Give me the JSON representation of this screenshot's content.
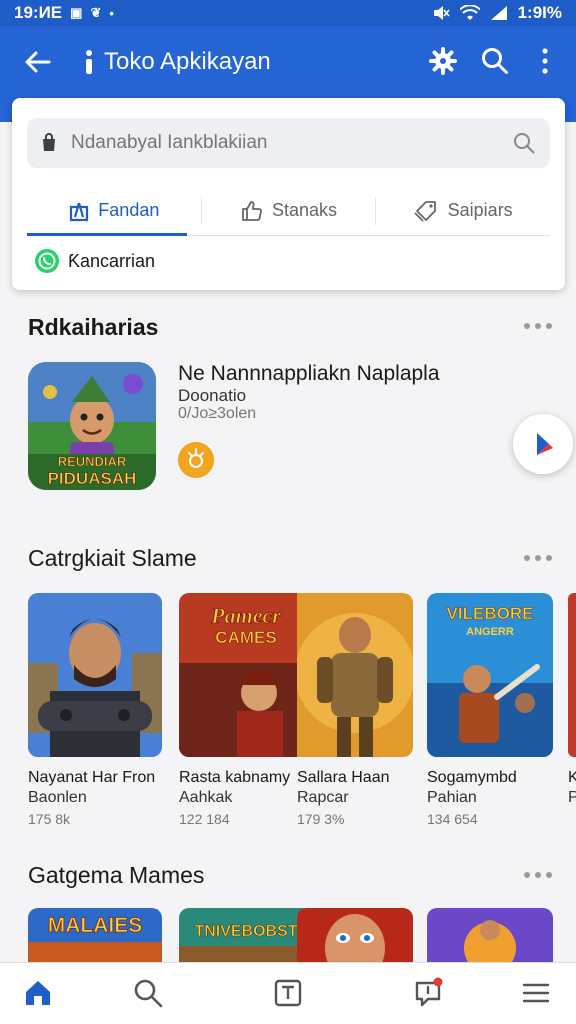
{
  "status_bar": {
    "time": "19:ИE",
    "right_text": "1:9I%"
  },
  "app_bar": {
    "title": "Toko Apkikayan"
  },
  "search": {
    "placeholder": "Ndanabyal Iankblakiian"
  },
  "tabs": [
    {
      "label": "Fandan",
      "active": true,
      "icon": "bag-icon"
    },
    {
      "label": "Stanaks",
      "active": false,
      "icon": "thumbs-up-icon"
    },
    {
      "label": "Saipiars",
      "active": false,
      "icon": "tag-icon"
    }
  ],
  "chip": {
    "label": "Ƙancarrian",
    "icon": "whatsapp-icon"
  },
  "section_1": {
    "title": "Rdkaiharias",
    "featured": {
      "title": "Ne Nannnappliakn Naplapla",
      "subtitle": "Doonatio",
      "meta": "0/Jo≥3olen",
      "art_text_top": "REUNDIAR",
      "art_text_bottom": "PIDUASAH"
    }
  },
  "section_2": {
    "title": "Catrgkiait Slame",
    "games": [
      {
        "name": "Nayanat Har Fron",
        "sub": "Baonlen",
        "stat": "175 8k",
        "art": "gamer"
      },
      {
        "name": "Rasta kabnamy",
        "sub": "Aahkak",
        "stat": "122 184",
        "art": "pamecr",
        "art_text_1": "Pamecr",
        "art_text_2": "CAMES"
      },
      {
        "name": "Sallara Haan",
        "sub": "Rapcar",
        "stat": "179 3%",
        "art": "warrior"
      },
      {
        "name": "Sogamymbd",
        "sub": "Pahian",
        "stat": "134 654",
        "art": "vilebore",
        "art_text_1": "VILEBORE",
        "art_text_2": "ANGERR"
      },
      {
        "name": "K",
        "sub": "P",
        "stat": "",
        "art": "partial"
      }
    ]
  },
  "section_3": {
    "title": "Gatgema Mames",
    "games": [
      {
        "art_text": "MALAIES"
      },
      {
        "art_text": "TNIVEBOBST"
      },
      {
        "art_text": ""
      },
      {
        "art_text": ""
      }
    ]
  },
  "colors": {
    "primary": "#2464d4",
    "status_bar": "#1e5cc8",
    "accent_orange": "#f3a51f",
    "chip_green": "#25d366",
    "notification": "#e53935"
  },
  "bottom_nav": [
    "home-icon",
    "search-icon",
    "library-icon",
    "notifications-icon",
    "menu-icon"
  ]
}
